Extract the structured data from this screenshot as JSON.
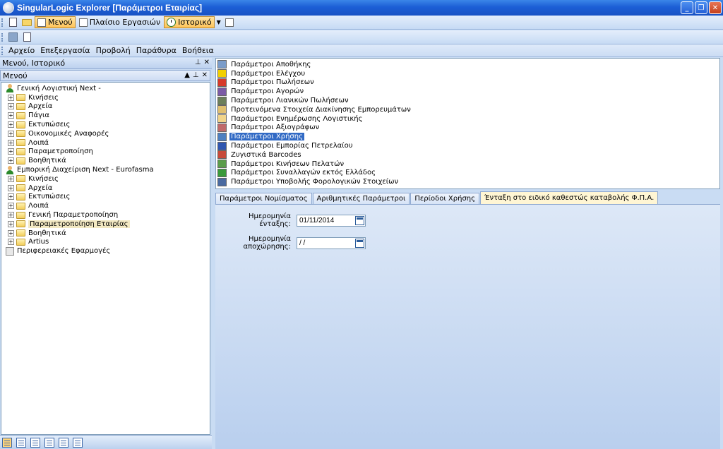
{
  "window": {
    "title": "SingularLogic Explorer [Παράμετροι Εταιρίας]"
  },
  "toolbar": {
    "menu_label": "Μενού",
    "workspace_label": "Πλαίσιο Εργασιών",
    "history_label": "Ιστορικό"
  },
  "menubar": [
    "Αρχείο",
    "Επεξεργασία",
    "Προβολή",
    "Παράθυρα",
    "Βοήθεια"
  ],
  "left_panel": {
    "header": "Μενού, Ιστορικό",
    "subheader": "Μενού",
    "tree": [
      {
        "label": "Γενική Λογιστική Next -",
        "type": "root"
      },
      {
        "label": "Κινήσεις",
        "type": "child"
      },
      {
        "label": "Αρχεία",
        "type": "child"
      },
      {
        "label": "Πάγια",
        "type": "child"
      },
      {
        "label": "Εκτυπώσεις",
        "type": "child"
      },
      {
        "label": "Οικονομικές Αναφορές",
        "type": "child"
      },
      {
        "label": "Λοιπά",
        "type": "child"
      },
      {
        "label": "Παραμετροποίηση",
        "type": "child"
      },
      {
        "label": "Βοηθητικά",
        "type": "child"
      },
      {
        "label": "Εμπορική Διαχείριση Next - Eurofasma",
        "type": "root"
      },
      {
        "label": "Κινήσεις",
        "type": "child"
      },
      {
        "label": "Αρχεία",
        "type": "child"
      },
      {
        "label": "Εκτυπώσεις",
        "type": "child"
      },
      {
        "label": "Λοιπά",
        "type": "child"
      },
      {
        "label": "Γενική Παραμετροποίηση",
        "type": "child"
      },
      {
        "label": "Παραμετροποίηση Εταιρίας",
        "type": "child"
      },
      {
        "label": "Βοηθητικά",
        "type": "child"
      },
      {
        "label": "Artius",
        "type": "child"
      },
      {
        "label": "Περιφερειακές Εφαρμογές",
        "type": "periph"
      }
    ]
  },
  "param_list": {
    "items": [
      {
        "label": "Παράμετροι Αποθήκης",
        "icon": "warehouse-icon",
        "color": "#7a9cc9"
      },
      {
        "label": "Παράμετροι Ελέγχου",
        "icon": "warning-icon",
        "color": "#f2d000"
      },
      {
        "label": "Παράμετροι Πωλήσεων",
        "icon": "sale-icon",
        "color": "#d63a2a"
      },
      {
        "label": "Παράμετροι Αγορών",
        "icon": "purchase-icon",
        "color": "#7b5aa6"
      },
      {
        "label": "Παράμετροι Λιανικών Πωλήσεων",
        "icon": "retail-icon",
        "color": "#6c7f5a"
      },
      {
        "label": "Προτεινόμενα Στοιχεία Διακίνησης Εμπορευμάτων",
        "icon": "shipping-icon",
        "color": "#e0c070"
      },
      {
        "label": "Παράμετροι Ενημέρωσης Λογιστικής",
        "icon": "ledger-icon",
        "color": "#f1d48a"
      },
      {
        "label": "Παράμετροι Αξιογράφων",
        "icon": "cheque-icon",
        "color": "#c06a6a"
      },
      {
        "label": "Παράμετροι Χρήσης",
        "icon": "usage-icon",
        "color": "#4d7fc0"
      },
      {
        "label": "Παράμετροι Εμπορίας Πετρελαίου",
        "icon": "oil-icon",
        "color": "#2f56b0"
      },
      {
        "label": "Ζυγιστικά Barcodes",
        "icon": "barcode-icon",
        "color": "#c74a3a"
      },
      {
        "label": "Παράμετροι Κινήσεων Πελατών",
        "icon": "customers-icon",
        "color": "#5b9c4a"
      },
      {
        "label": "Παράμετροι Συναλλαγών εκτός Ελλάδος",
        "icon": "foreign-icon",
        "color": "#3a9a3a"
      },
      {
        "label": "Παράμετροι Υποβολής Φορολογικών Στοιχείων",
        "icon": "tax-icon",
        "color": "#4a6aa0"
      }
    ],
    "selected_index": 8
  },
  "tabs": [
    {
      "label": "Παράμετροι Νομίσματος"
    },
    {
      "label": "Αριθμητικές Παράμετροι"
    },
    {
      "label": "Περίοδοι Χρήσης"
    },
    {
      "label": "Ένταξη στο ειδικό καθεστώς καταβολής Φ.Π.Α."
    }
  ],
  "active_tab": 3,
  "form": {
    "entry_date_label": "Ημερομηνία ένταξης:",
    "entry_date_value": "01/11/2014",
    "exit_date_label": "Ημερομηνία αποχώρησης:",
    "exit_date_value": " /  /"
  },
  "colors": {
    "selection": "#316ac5",
    "accent": "#1c5fd6",
    "active_tab": "#fff6d4"
  }
}
